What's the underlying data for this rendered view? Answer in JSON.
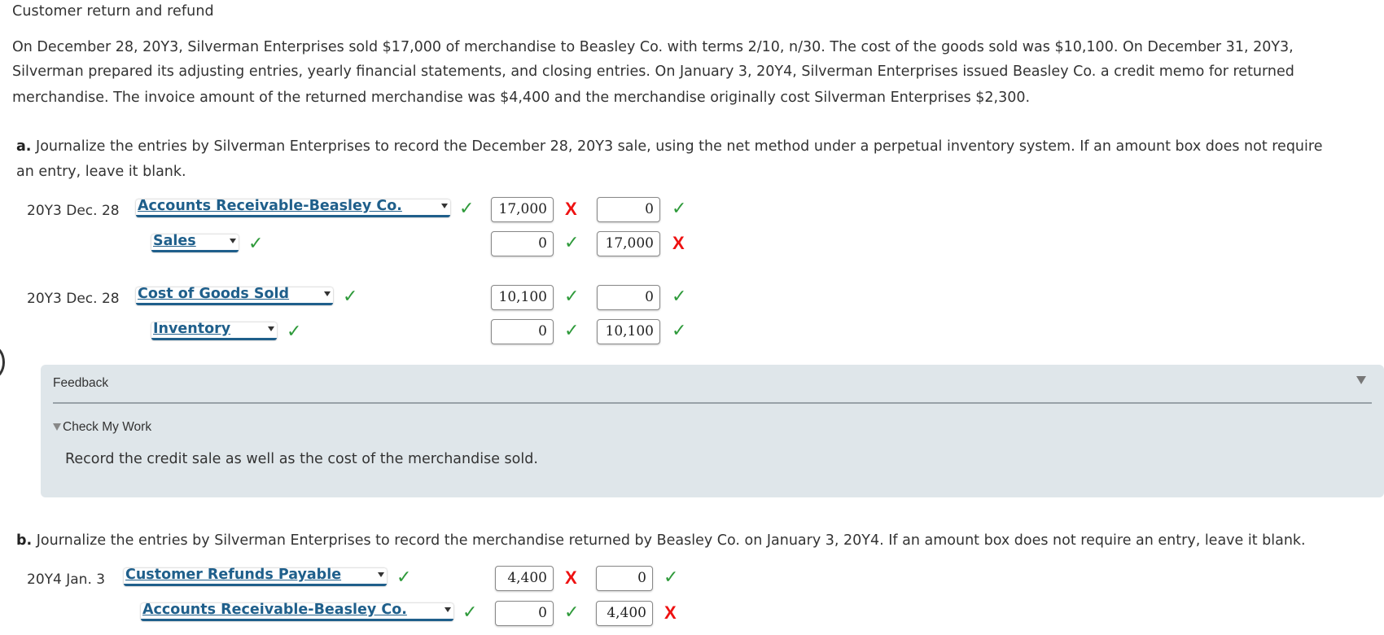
{
  "title": "Customer return and refund",
  "paragraph": [
    "On December 28, 20Y3, Silverman Enterprises sold $17,000 of merchandise to Beasley Co. with terms 2/10, n/30. The cost of the goods sold was $10,100. On December 31, 20Y3,",
    "Silverman prepared its adjusting entries, yearly financial statements, and closing entries. On January 3, 20Y4, Silverman Enterprises issued Beasley Co. a credit memo for returned",
    "merchandise. The invoice amount of the returned merchandise was $4,400 and the merchandise originally cost Silverman Enterprises $2,300."
  ],
  "part_a": {
    "letter": "a.",
    "instruction_line1": "Journalize the entries by Silverman Enterprises to record the December 28, 20Y3 sale, using the net method under a perpetual inventory system. If an amount box does not require",
    "instruction_line2": "an entry, leave it blank.",
    "entries": [
      {
        "date": "20Y3 Dec. 28",
        "account": "Accounts Receivable-Beasley Co.",
        "account_status": "correct",
        "debit": "17,000",
        "debit_status": "incorrect",
        "credit": "0",
        "credit_status": "correct"
      },
      {
        "date": "",
        "account": "Sales",
        "account_status": "correct",
        "debit": "0",
        "debit_status": "correct",
        "credit": "17,000",
        "credit_status": "incorrect"
      },
      {
        "date": "20Y3 Dec. 28",
        "account": "Cost of Goods Sold",
        "account_status": "correct",
        "debit": "10,100",
        "debit_status": "correct",
        "credit": "0",
        "credit_status": "correct"
      },
      {
        "date": "",
        "account": "Inventory",
        "account_status": "correct",
        "debit": "0",
        "debit_status": "correct",
        "credit": "10,100",
        "credit_status": "correct"
      }
    ]
  },
  "feedback": {
    "label": "Feedback",
    "check_my_work": "Check My Work",
    "text": "Record the credit sale as well as the cost of the merchandise sold."
  },
  "part_b": {
    "letter": "b.",
    "instruction": "Journalize the entries by Silverman Enterprises to record the merchandise returned by Beasley Co. on January 3, 20Y4. If an amount box does not require an entry, leave it blank.",
    "entries": [
      {
        "date": "20Y4 Jan. 3",
        "account": "Customer Refunds Payable",
        "account_status": "correct",
        "debit": "4,400",
        "debit_status": "incorrect",
        "credit": "0",
        "credit_status": "correct"
      },
      {
        "date": "",
        "account": "Accounts Receivable-Beasley Co.",
        "account_status": "correct",
        "debit": "0",
        "debit_status": "correct",
        "credit": "4,400",
        "credit_status": "incorrect"
      }
    ]
  },
  "marks": {
    "correct": "✓",
    "incorrect": "X"
  },
  "colors": {
    "correct": "#2e9a3a",
    "incorrect": "#ee1111",
    "account_link": "#1f5f8b",
    "feedback_bg": "#dfe6ea"
  }
}
